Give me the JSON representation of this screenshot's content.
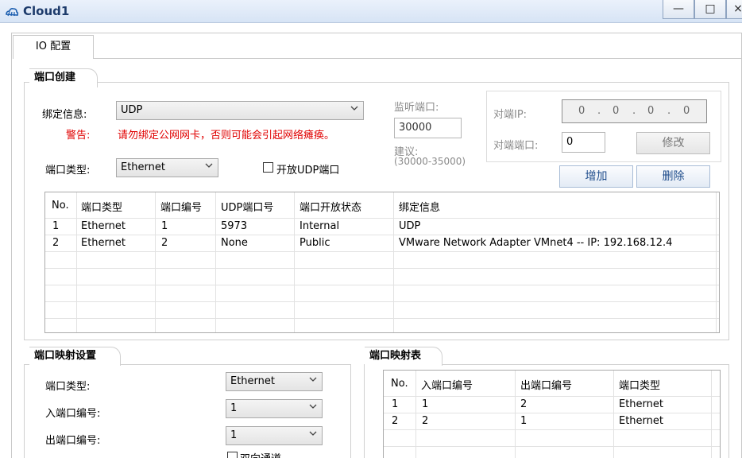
{
  "window": {
    "title": "Cloud1",
    "minimize": "—",
    "maximize": "□",
    "close": "×"
  },
  "tabs": [
    {
      "label": "IO 配置"
    }
  ],
  "port_create": {
    "group_title": "端口创建",
    "bind_label": "绑定信息:",
    "bind_value": "UDP",
    "warning_label": "警告:",
    "warning_text": "请勿绑定公网网卡，否则可能会引起网络瘫痪。",
    "port_type_label": "端口类型:",
    "port_type_value": "Ethernet",
    "open_udp_label": "开放UDP端口",
    "listen_label": "监听端口:",
    "listen_value": "30000",
    "suggest_label": "建议:",
    "suggest_range": "(30000-35000)",
    "peer_ip_label": "对端IP:",
    "peer_ip_octets": [
      "0",
      "0",
      "0",
      "0"
    ],
    "peer_port_label": "对端端口:",
    "peer_port_value": "0",
    "modify_button": "修改",
    "add_button": "增加",
    "delete_button": "删除"
  },
  "port_table": {
    "headers": [
      "No.",
      "端口类型",
      "端口编号",
      "UDP端口号",
      "端口开放状态",
      "绑定信息"
    ],
    "rows": [
      [
        "1",
        "Ethernet",
        "1",
        "5973",
        "Internal",
        "UDP"
      ],
      [
        "2",
        "Ethernet",
        "2",
        "None",
        "Public",
        "VMware Network Adapter VMnet4 -- IP: 192.168.12.4"
      ]
    ]
  },
  "port_map_settings": {
    "group_title": "端口映射设置",
    "port_type_label": "端口类型:",
    "port_type_value": "Ethernet",
    "in_port_label": "入端口编号:",
    "in_port_value": "1",
    "out_port_label": "出端口编号:",
    "out_port_value": "1",
    "bidirectional_label": "双向通道"
  },
  "port_map_table": {
    "group_title": "端口映射表",
    "headers": [
      "No.",
      "入端口编号",
      "出端口编号",
      "端口类型"
    ],
    "rows": [
      [
        "1",
        "1",
        "2",
        "Ethernet"
      ],
      [
        "2",
        "2",
        "1",
        "Ethernet"
      ]
    ]
  },
  "colors": {
    "warning": "#e00000",
    "button_text": "#1f4d8c",
    "title_bar": "#d7e4f5"
  }
}
